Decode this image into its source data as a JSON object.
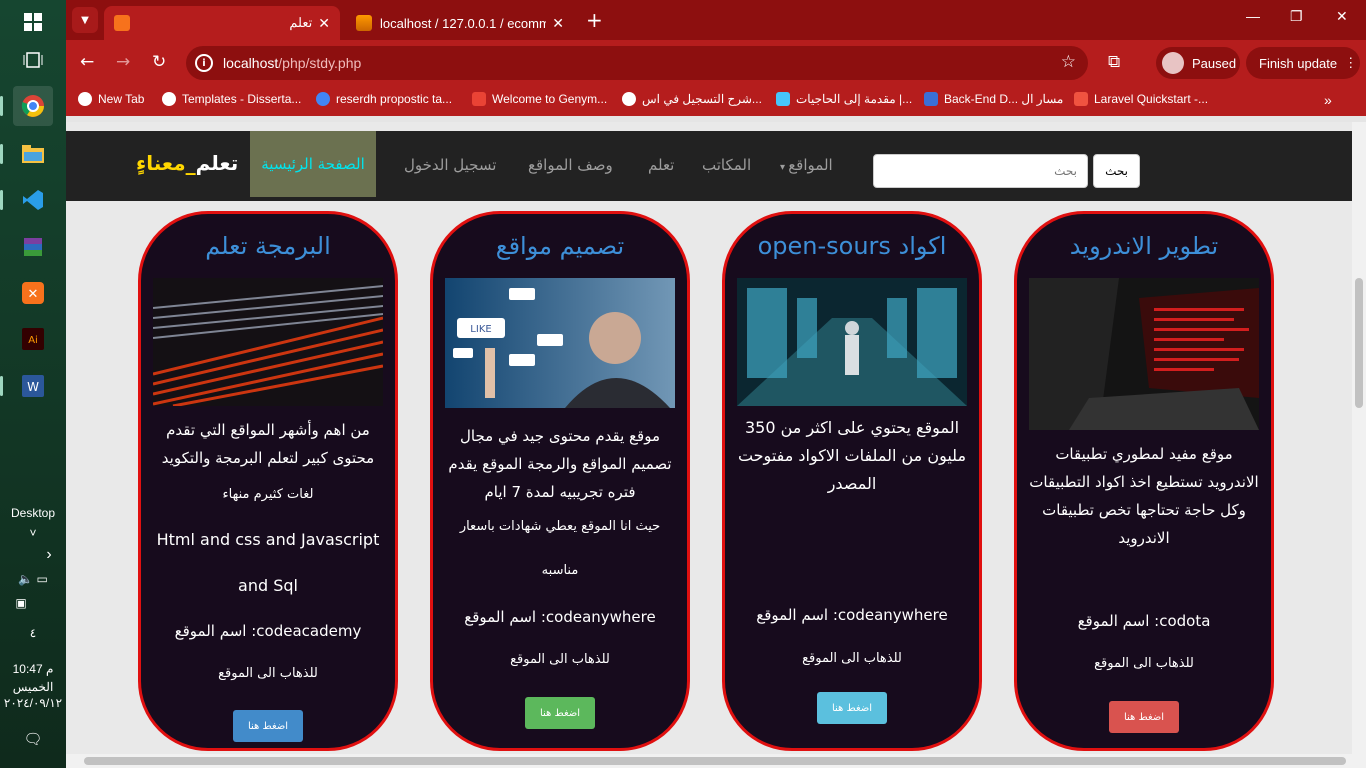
{
  "taskbar": {
    "desktop_label": "Desktop",
    "num": "٤",
    "time": "10:47 م",
    "day": "الخميس",
    "date": "٢٠٢٤/٠٩/١٢"
  },
  "browser": {
    "tabs": [
      {
        "title": "تعلم",
        "icon": "xampp-icon"
      },
      {
        "title": "localhost / 127.0.0.1 / ecommer",
        "icon": "phpmyadmin-icon"
      }
    ],
    "url_host": "localhost",
    "url_path": "/php/stdy.php",
    "profile_label": "Paused",
    "finish_update_label": "Finish update",
    "bookmarks": [
      "New Tab",
      "Templates - Disserta...",
      "reserdh propostic ta...",
      "Welcome to Genym...",
      "شرح التسجيل في اس...",
      "مقدمة إلى الحاجيات |...",
      "Back-End D... مسار ال",
      "Laravel Quickstart -..."
    ]
  },
  "site": {
    "brand_main": "تعلم",
    "brand_accent": "_معناءٍ",
    "nav": {
      "home": "الصفحة الرئيسية",
      "login": "تسجيل الدخول",
      "describe": "وصف المواقع",
      "learn": "تعلم",
      "libraries": "المكاتب",
      "sites": "المواقع"
    },
    "search_placeholder": "بحث",
    "search_button": "بحث"
  },
  "cards": [
    {
      "title": "البرمجة تعلم",
      "desc": "من اهم وأشهر المواقع التي تقدم محتوى كبير لتعلم البرمجة والتكويد",
      "extra1": "لغات كثيرم منهاء",
      "extra2": "Html and css and Javascript",
      "extra3": "and Sql",
      "site": "اسم الموقع :codeacademy",
      "go": "للذهاب الى الموقع",
      "button": "اضغط هنا",
      "btn_color": "#428bca"
    },
    {
      "title": "تصميم مواقع",
      "desc": "موقع يقدم محتوى جيد في مجال تصميم المواقع والرمجة الموقع يقدم فتره تجريبيه لمدة 7 ايام",
      "extra1": "حيث انا الموقع يعطي شهادات باسعار",
      "extra2": "مناسبه",
      "site": "اسم الموقع :codeanywhere",
      "go": "للذهاب الى الموقع",
      "button": "اضغط هنا",
      "btn_color": "#5cb85c"
    },
    {
      "title": "open-sours اكواد",
      "desc": "الموقع يحتوي على اكثر من 350 مليون من الملفات الاكواد مفتوحت المصدر",
      "site": "اسم الموقع :codeanywhere",
      "go": "للذهاب الى الموقع",
      "button": "اضغط هنا",
      "btn_color": "#5bc0de"
    },
    {
      "title": "تطوير الاندرويد",
      "desc": "موقع مفيد لمطوري تطبيقات الاندرويد تستطيع اخذ اكواد التطبيقات وكل حاجة تحتاجها تخص تطبيقات الاندرويد",
      "site": "اسم الموقع :codota",
      "go": "للذهاب الى الموقع",
      "button": "اضغط هنا",
      "btn_color": "#d9534f"
    }
  ]
}
